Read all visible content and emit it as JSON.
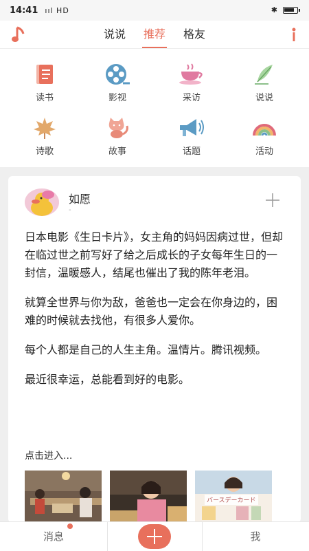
{
  "status_bar": {
    "time": "14:41",
    "signal": "ııl HD"
  },
  "top_nav": {
    "tabs": [
      {
        "label": "说说",
        "active": false
      },
      {
        "label": "推荐",
        "active": true
      },
      {
        "label": "格友",
        "active": false
      }
    ],
    "accent": "#e8705c"
  },
  "categories": [
    {
      "label": "读书",
      "icon": "book-icon",
      "color": "#e8705c"
    },
    {
      "label": "影视",
      "icon": "film-reel-icon",
      "color": "#5b9bc4"
    },
    {
      "label": "采访",
      "icon": "teacup-icon",
      "color": "#e07aa0"
    },
    {
      "label": "说说",
      "icon": "quill-icon",
      "color": "#8cc08a"
    },
    {
      "label": "诗歌",
      "icon": "maple-leaf-icon",
      "color": "#e2a86b"
    },
    {
      "label": "故事",
      "icon": "cat-icon",
      "color": "#e88a78"
    },
    {
      "label": "话题",
      "icon": "megaphone-icon",
      "color": "#5b9bc4"
    },
    {
      "label": "活动",
      "icon": "rainbow-icon",
      "color": "#e06a7a"
    }
  ],
  "post": {
    "username": "如愿",
    "subline": "-",
    "paragraphs": [
      "日本电影《生日卡片》，女主角的妈妈因病过世，但却在临过世之前写好了给之后成长的子女每年生日的一封信，温暖感人，结尾也催出了我的陈年老泪。",
      "就算全世界与你为敌，爸爸也一定会在你身边的，困难的时候就去找他，有很多人爱你。",
      "每个人都是自己的人生主角。温情片。腾讯视频。",
      "最近很幸运，总能看到好的电影。"
    ],
    "enter_link": "点击进入...",
    "thumb_text": "バースデーカード"
  },
  "bottom_bar": {
    "messages_label": "消息",
    "me_label": "我"
  }
}
